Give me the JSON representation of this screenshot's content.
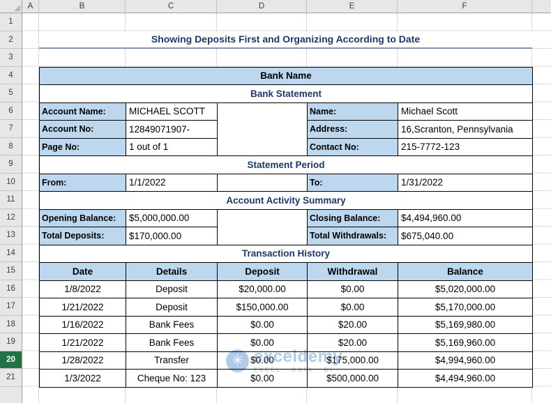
{
  "sheet_title": "Showing Deposits First and Organizing According to Date",
  "excel": {
    "column_headers": [
      "A",
      "B",
      "C",
      "D",
      "E",
      "F"
    ],
    "row_headers": [
      "1",
      "2",
      "3",
      "4",
      "5",
      "6",
      "7",
      "8",
      "9",
      "10",
      "11",
      "12",
      "13",
      "14",
      "15",
      "16",
      "17",
      "18",
      "19",
      "20",
      "21"
    ],
    "selected_row": "20"
  },
  "statement": {
    "bank_name": "Bank Name",
    "sections": {
      "bank_statement": "Bank Statement",
      "statement_period": "Statement Period",
      "account_activity": "Account Activity Summary",
      "transaction_history": "Transaction History"
    },
    "account_info_left": [
      {
        "label": "Account Name:",
        "value": "MICHAEL SCOTT"
      },
      {
        "label": "Account No:",
        "value": "12849071907-"
      },
      {
        "label": "Page No:",
        "value": "1 out of 1"
      }
    ],
    "account_info_right": [
      {
        "label": "Name:",
        "value": "Michael Scott"
      },
      {
        "label": "Address:",
        "value": "16,Scranton, Pennsylvania"
      },
      {
        "label": "Contact No:",
        "value": "215-7772-123"
      }
    ],
    "period": {
      "from_label": "From:",
      "from_value": "1/1/2022",
      "to_label": "To:",
      "to_value": "1/31/2022"
    },
    "summary_left": [
      {
        "label": "Opening Balance:",
        "value": "$5,000,000.00"
      },
      {
        "label": "Total Deposits:",
        "value": "$170,000.00"
      }
    ],
    "summary_right": [
      {
        "label": "Closing Balance:",
        "value": "$4,494,960.00"
      },
      {
        "label": "Total Withdrawals:",
        "value": "$675,040.00"
      }
    ],
    "transactions": {
      "headers": [
        "Date",
        "Details",
        "Deposit",
        "Withdrawal",
        "Balance"
      ],
      "rows": [
        {
          "date": "1/8/2022",
          "details": "Deposit",
          "deposit": "$20,000.00",
          "withdrawal": "$0.00",
          "balance": "$5,020,000.00"
        },
        {
          "date": "1/21/2022",
          "details": "Deposit",
          "deposit": "$150,000.00",
          "withdrawal": "$0.00",
          "balance": "$5,170,000.00"
        },
        {
          "date": "1/16/2022",
          "details": "Bank Fees",
          "deposit": "$0.00",
          "withdrawal": "$20.00",
          "balance": "$5,169,980.00"
        },
        {
          "date": "1/21/2022",
          "details": "Bank Fees",
          "deposit": "$0.00",
          "withdrawal": "$20.00",
          "balance": "$5,169,960.00"
        },
        {
          "date": "1/28/2022",
          "details": "Transfer",
          "deposit": "$0.00",
          "withdrawal": "$175,000.00",
          "balance": "$4,994,960.00"
        },
        {
          "date": "1/3/2022",
          "details": "Cheque No: 123",
          "deposit": "$0.00",
          "withdrawal": "$500,000.00",
          "balance": "$4,494,960.00"
        }
      ]
    }
  },
  "watermark": {
    "name": "exceldemy",
    "tagline": "EXCEL · DATA · BI"
  },
  "colors": {
    "cell_fill_blue": "#BDD7EE",
    "accent_navy": "#1F3864",
    "selected_row_green": "#217346",
    "gridline": "#D8D8D8"
  }
}
